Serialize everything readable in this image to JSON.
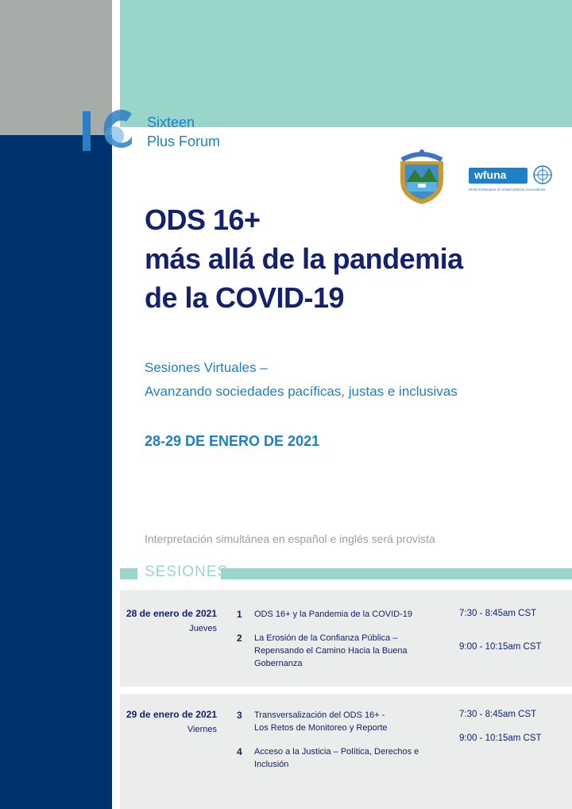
{
  "logo": {
    "number": "16",
    "line1": "Sixteen",
    "line2": "Plus Forum"
  },
  "partners": {
    "wfuna_name": "wfuna",
    "wfuna_caption": "World Federation of United Nations Associations"
  },
  "title": {
    "line1": "ODS 16+",
    "line2": "más allá de la pandemia",
    "line3": "de la COVID-19"
  },
  "subtitle": {
    "line1": "Sesiones Virtuales –",
    "line2": "Avanzando sociedades pacíficas, justas e inclusivas"
  },
  "event_date": "28-29 DE ENERO DE 2021",
  "interpretation_note": "Interpretación simultánea en español e inglés será provista",
  "sessions_heading": "SESIONES",
  "days": [
    {
      "date": "28 de enero de 2021",
      "weekday": "Jueves",
      "sessions": [
        {
          "num": "1",
          "title": "ODS 16+ y la Pandemia de la COVID-19",
          "time": "7:30 - 8:45am CST"
        },
        {
          "num": "2",
          "title": "La Erosión de la Confianza Pública – Repensando el Camino Hacia la Buena Gobernanza",
          "time": "9:00 - 10:15am CST"
        }
      ]
    },
    {
      "date": "29 de enero de 2021",
      "weekday": "Viernes",
      "sessions": [
        {
          "num": "3",
          "title": "Transversalización del ODS 16+ - Los Retos de Monitoreo y Reporte",
          "time": "7:30 - 8:45am CST"
        },
        {
          "num": "4",
          "title": "Acceso a la Justicia – Política, Derechos e Inclusión",
          "time": "9:00 - 10:15am CST"
        }
      ]
    }
  ],
  "colors": {
    "navy": "#003270",
    "teal": "#99d5cb",
    "gray": "#a6aca7",
    "blue_text": "#1d7fc4",
    "dark_text": "#13216e",
    "band": "#ebedec"
  }
}
